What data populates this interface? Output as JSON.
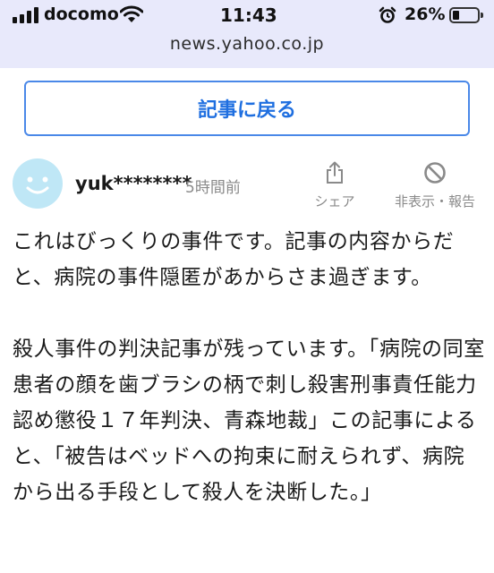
{
  "status_bar": {
    "carrier": "docomo",
    "time": "11:43",
    "battery_percent": "26%",
    "battery_level": 0.26,
    "icons": [
      "signal-icon",
      "wifi-icon",
      "alarm-icon",
      "battery-icon"
    ]
  },
  "browser": {
    "url": "news.yahoo.co.jp"
  },
  "back_button": {
    "label": "記事に戻る"
  },
  "comment": {
    "username": "yuk********",
    "posted_time": "5時間前",
    "share_label": "シェア",
    "hide_report_label": "非表示・報告",
    "paragraph_1": "これはびっくりの事件です。記事の内容からだと、病院の事件隠匿があからさま過ぎます。",
    "paragraph_2": "殺人事件の判決記事が残っています。「病院の同室患者の顔を歯ブラシの柄で刺し殺害刑事責任能力認め懲役１７年判決、青森地裁」この記事によると、「被告はベッドへの拘束に耐えられず、病院から出る手段として殺人を決断した。」"
  },
  "colors": {
    "status_bar_bg": "#e8e9fb",
    "accent_blue": "#1f6fe0",
    "muted_text": "#8a8a8a",
    "avatar_bg": "#bfe7f6"
  }
}
